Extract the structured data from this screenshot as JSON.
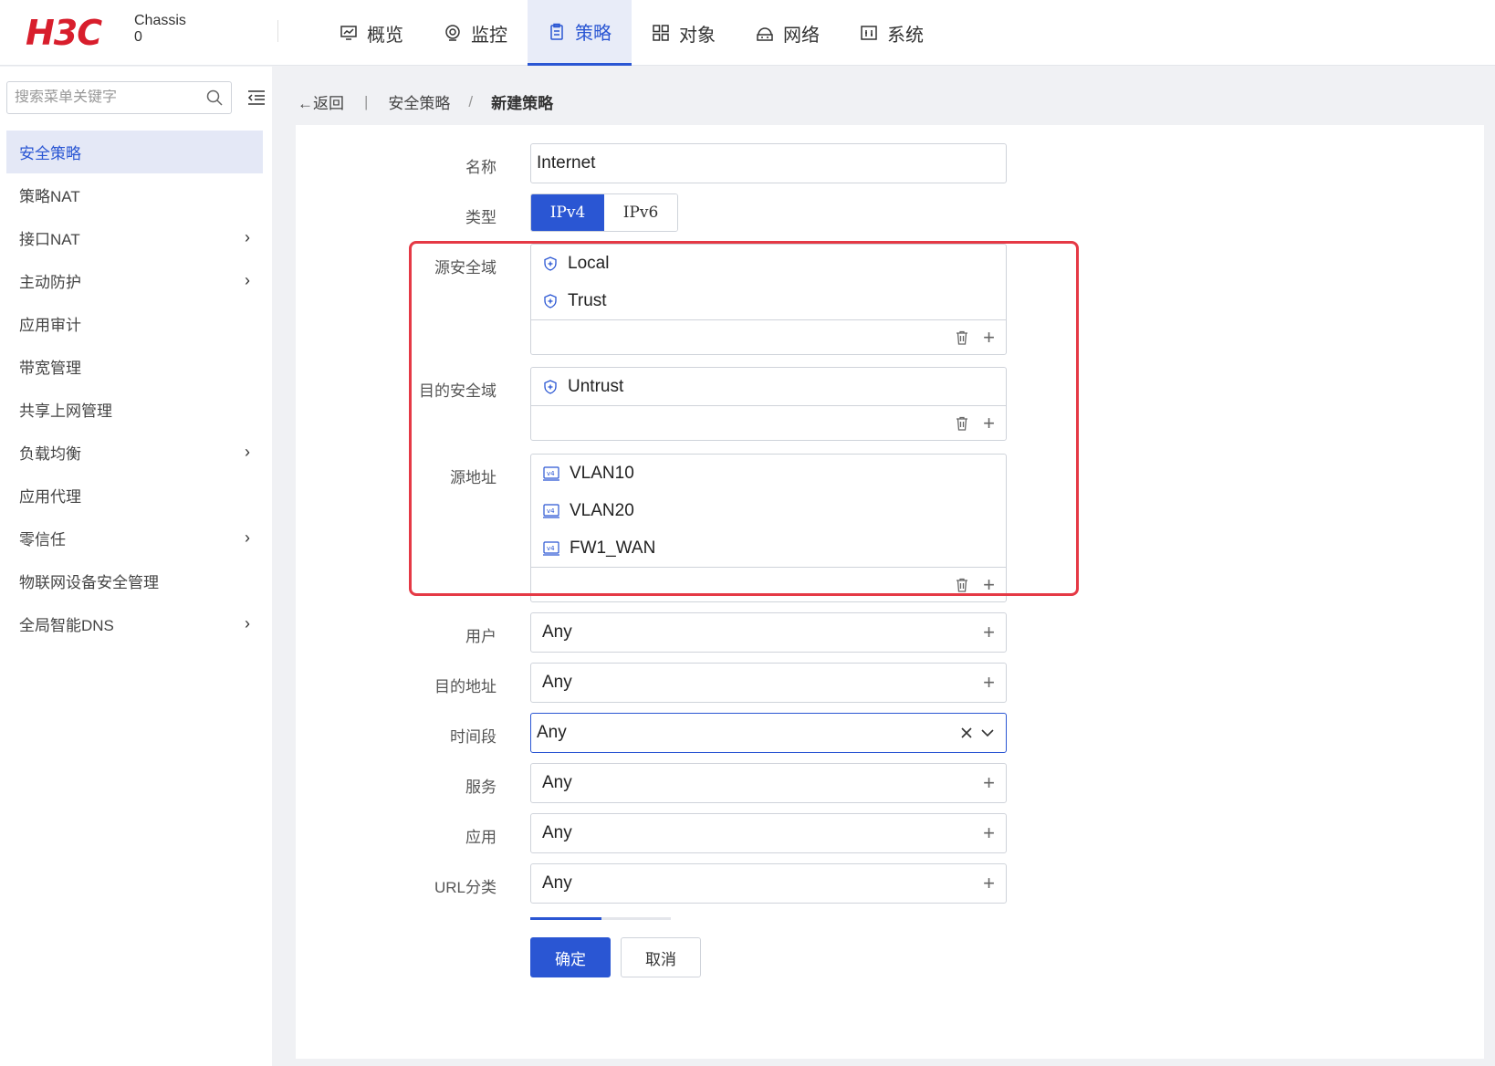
{
  "header": {
    "logo": "H3C",
    "chassis_line1": "Chassis",
    "chassis_line2": "0",
    "nav": [
      {
        "label": "概览",
        "icon": "monitor-icon"
      },
      {
        "label": "监控",
        "icon": "target-icon"
      },
      {
        "label": "策略",
        "icon": "clipboard-icon",
        "active": true
      },
      {
        "label": "对象",
        "icon": "grid-icon"
      },
      {
        "label": "网络",
        "icon": "network-icon"
      },
      {
        "label": "系统",
        "icon": "system-icon"
      }
    ]
  },
  "sidebar": {
    "search_placeholder": "搜索菜单关键字",
    "items": [
      {
        "label": "安全策略",
        "active": true,
        "has_children": false
      },
      {
        "label": "策略NAT",
        "has_children": false
      },
      {
        "label": "接口NAT",
        "has_children": true
      },
      {
        "label": "主动防护",
        "has_children": true
      },
      {
        "label": "应用审计",
        "has_children": false
      },
      {
        "label": "带宽管理",
        "has_children": false
      },
      {
        "label": "共享上网管理",
        "has_children": false
      },
      {
        "label": "负载均衡",
        "has_children": true
      },
      {
        "label": "应用代理",
        "has_children": false
      },
      {
        "label": "零信任",
        "has_children": true
      },
      {
        "label": "物联网设备安全管理",
        "has_children": false
      },
      {
        "label": "全局智能DNS",
        "has_children": true
      }
    ]
  },
  "breadcrumb": {
    "back": "←返回",
    "separator": "|",
    "level1": "安全策略",
    "slash": "/",
    "level2": "新建策略"
  },
  "form": {
    "name_label": "名称",
    "name_value": "Internet",
    "type_label": "类型",
    "type_options": [
      "IPv4",
      "IPv6"
    ],
    "type_selected": "IPv4",
    "src_zone_label": "源安全域",
    "src_zones": [
      "Local",
      "Trust"
    ],
    "dst_zone_label": "目的安全域",
    "dst_zones": [
      "Untrust"
    ],
    "src_addr_label": "源地址",
    "src_addrs": [
      "VLAN10",
      "VLAN20",
      "FW1_WAN"
    ],
    "user_label": "用户",
    "user_value": "Any",
    "dst_addr_label": "目的地址",
    "dst_addr_value": "Any",
    "time_label": "时间段",
    "time_value": "Any",
    "service_label": "服务",
    "service_value": "Any",
    "app_label": "应用",
    "app_value": "Any",
    "url_label": "URL分类",
    "url_value": "Any",
    "ok_button": "确定",
    "cancel_button": "取消"
  },
  "colors": {
    "accent": "#2a56d3",
    "logo_red": "#d81e2c",
    "highlight_red": "#e53945"
  }
}
